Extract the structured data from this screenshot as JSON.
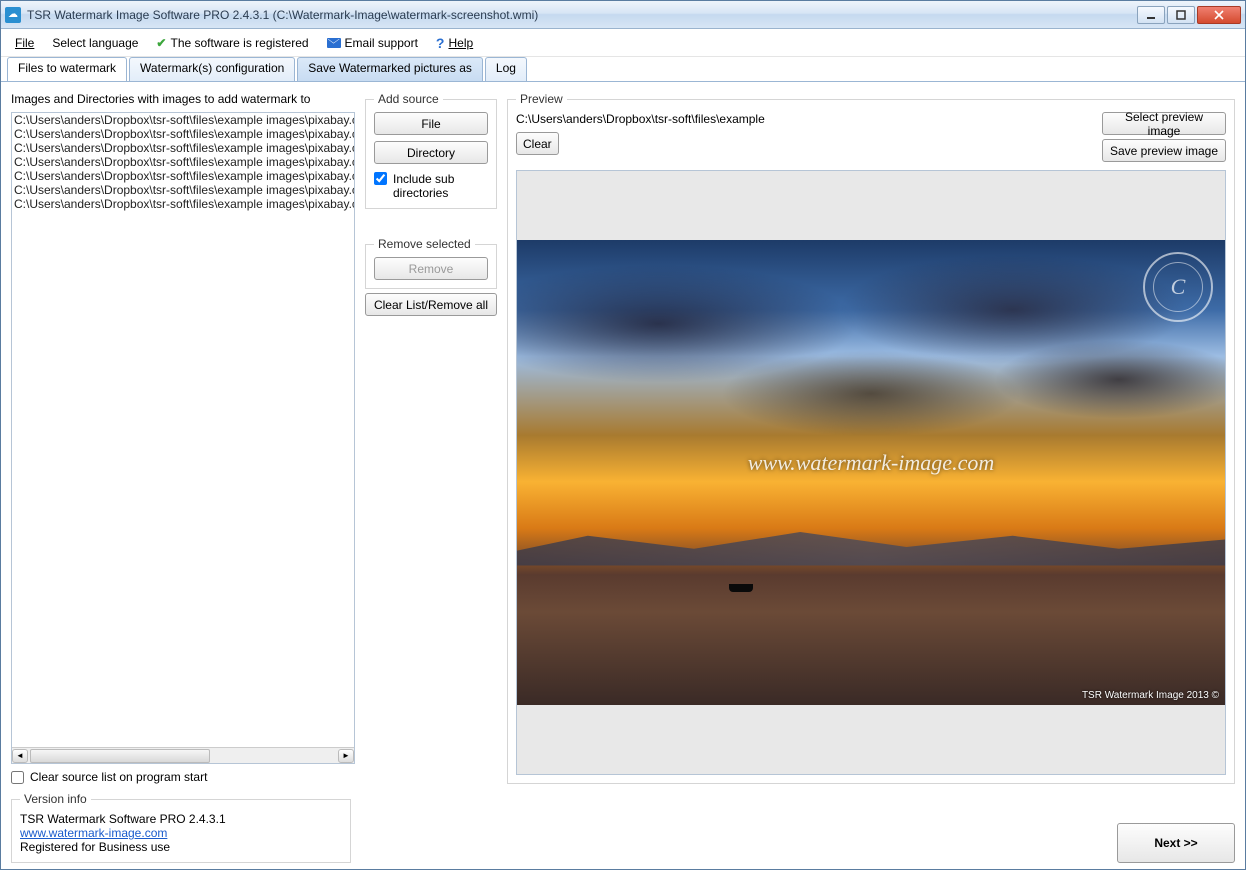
{
  "title": "TSR Watermark Image Software PRO 2.4.3.1 (C:\\Watermark-Image\\watermark-screenshot.wmi)",
  "menu": {
    "file": "File",
    "lang": "Select language",
    "registered": "The software is registered",
    "email": "Email support",
    "help": "Help"
  },
  "tabs": {
    "t1": "Files to watermark",
    "t2": "Watermark(s) configuration",
    "t3": "Save Watermarked pictures as",
    "t4": "Log"
  },
  "left": {
    "header": "Images and Directories with images to add watermark to",
    "clear_on_start": "Clear source list on program start",
    "items": [
      "C:\\Users\\anders\\Dropbox\\tsr-soft\\files\\example images\\pixabay.co",
      "C:\\Users\\anders\\Dropbox\\tsr-soft\\files\\example images\\pixabay.co",
      "C:\\Users\\anders\\Dropbox\\tsr-soft\\files\\example images\\pixabay.co",
      "C:\\Users\\anders\\Dropbox\\tsr-soft\\files\\example images\\pixabay.co",
      "C:\\Users\\anders\\Dropbox\\tsr-soft\\files\\example images\\pixabay.co",
      "C:\\Users\\anders\\Dropbox\\tsr-soft\\files\\example images\\pixabay.co",
      "C:\\Users\\anders\\Dropbox\\tsr-soft\\files\\example images\\pixabay.co"
    ]
  },
  "mid": {
    "add_source": "Add source",
    "file": "File",
    "directory": "Directory",
    "include_sub": "Include sub directories",
    "remove_selected": "Remove selected",
    "remove": "Remove",
    "clear_all": "Clear List/Remove all"
  },
  "preview": {
    "legend": "Preview",
    "path": "C:\\Users\\anders\\Dropbox\\tsr-soft\\files\\example",
    "clear": "Clear",
    "select": "Select preview image",
    "save": "Save preview image",
    "watermark_text": "www.watermark-image.com",
    "corner_text": "TSR Watermark Image 2013 ©",
    "copyright_glyph": "C"
  },
  "version": {
    "legend": "Version info",
    "line1": "TSR Watermark Software PRO 2.4.3.1",
    "link": "www.watermark-image.com",
    "line3": "Registered for Business use"
  },
  "next": "Next >>"
}
